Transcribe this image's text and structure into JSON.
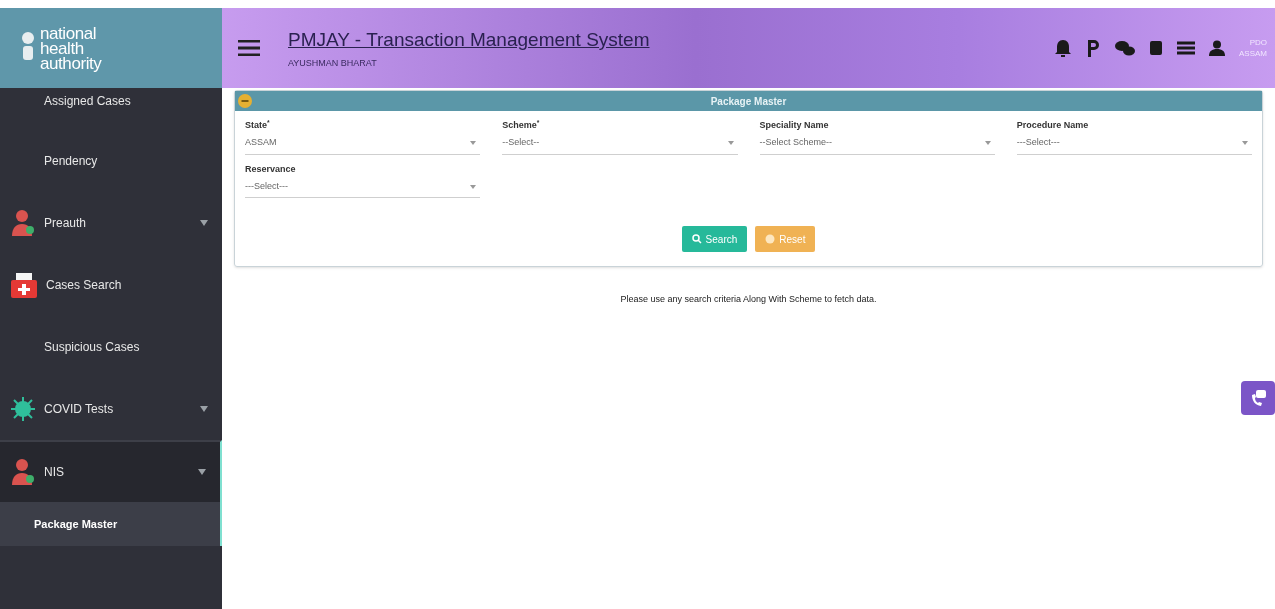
{
  "logo": {
    "lines": [
      "national",
      "health",
      "authority"
    ]
  },
  "header": {
    "title": "PMJAY - Transaction Management System",
    "subtitle": "AYUSHMAN BHARAT",
    "user": [
      "PDO",
      "ASSAM"
    ]
  },
  "sidebar": {
    "items": [
      {
        "label": "Assigned Cases",
        "kind": "plain",
        "expandable": false,
        "expanded": false
      },
      {
        "label": "Pendency",
        "kind": "plain",
        "expandable": false,
        "expanded": false
      },
      {
        "label": "Preauth",
        "kind": "person",
        "expandable": true,
        "expanded": false
      },
      {
        "label": "Cases Search",
        "kind": "kit",
        "expandable": false,
        "expanded": false
      },
      {
        "label": "Suspicious Cases",
        "kind": "plain",
        "expandable": false,
        "expanded": false
      },
      {
        "label": "COVID Tests",
        "kind": "virus",
        "expandable": true,
        "expanded": false
      },
      {
        "label": "NIS",
        "kind": "person",
        "expandable": true,
        "expanded": true,
        "children": [
          {
            "label": "Package Master",
            "selected": true
          }
        ]
      }
    ]
  },
  "panel": {
    "title": "Package Master",
    "fields": [
      {
        "label": "State$^{*}$",
        "value": "ASSAM"
      },
      {
        "label": "Scheme$^{*}$",
        "value": "--Select--"
      },
      {
        "label": "Speciality Name",
        "value": "--Select Scheme--"
      },
      {
        "label": "Procedure Name",
        "value": "---Select---"
      },
      {
        "label": "Reservance",
        "value": "---Select---"
      }
    ],
    "buttons": [
      {
        "label": "Search",
        "kind": "search"
      },
      {
        "label": "Reset",
        "kind": "reset"
      }
    ]
  },
  "message": "Please use any search criteria Along With Scheme to fetch data."
}
